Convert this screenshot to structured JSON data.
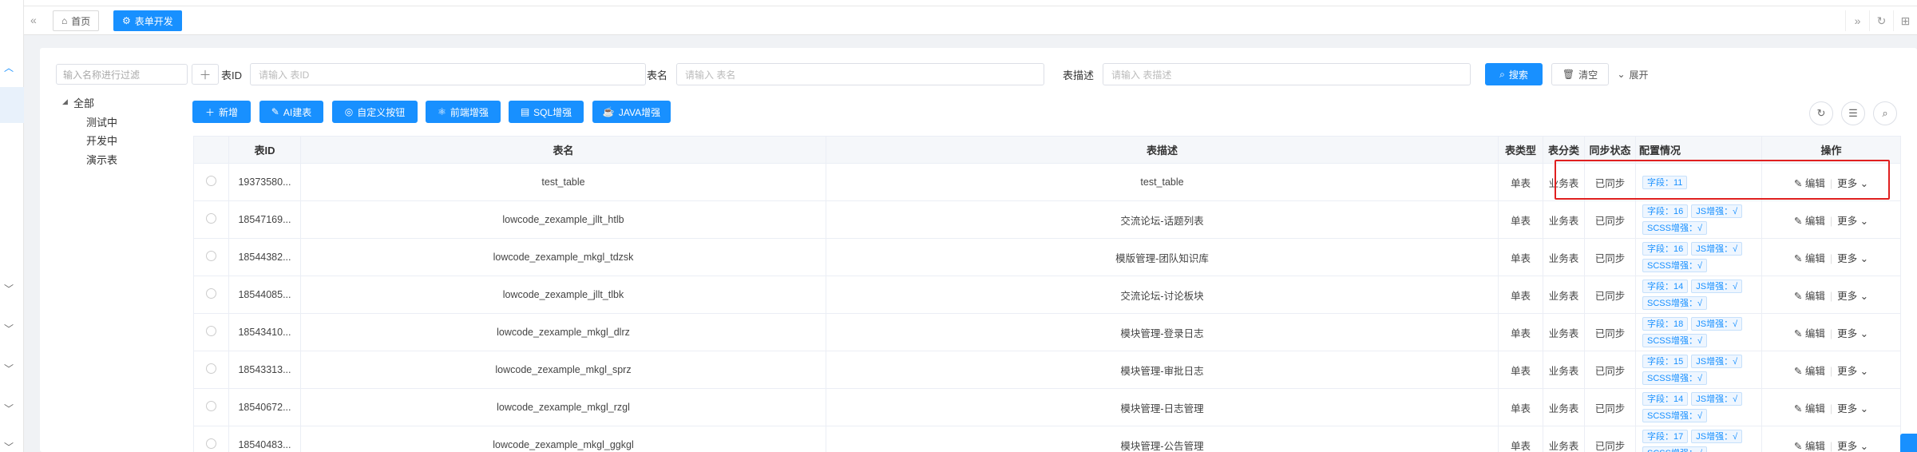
{
  "tabs": [
    {
      "label": "首页",
      "icon": "home-icon"
    },
    {
      "label": "表单开发",
      "icon": "form-icon"
    }
  ],
  "tree": {
    "search_placeholder": "输入名称进行过滤",
    "root": "全部",
    "children": [
      "测试中",
      "开发中",
      "演示表"
    ]
  },
  "query": {
    "id_label": "表ID",
    "id_placeholder": "请输入 表ID",
    "name_label": "表名",
    "name_placeholder": "请输入 表名",
    "desc_label": "表描述",
    "desc_placeholder": "请输入 表描述",
    "search": "搜索",
    "clear": "清空",
    "expand": "展开"
  },
  "toolbar": {
    "add": "新增",
    "ai": "AI建表",
    "custom": "自定义按钮",
    "frontend": "前端增强",
    "sql": "SQL增强",
    "java": "JAVA增强"
  },
  "columns": [
    "表ID",
    "表名",
    "表描述",
    "表类型",
    "表分类",
    "同步状态",
    "配置情况",
    "操作"
  ],
  "rows": [
    {
      "id": "19373580...",
      "name": "test_table",
      "desc": "test_table",
      "type": "单表",
      "category": "业务表",
      "sync": "已同步",
      "tags": [
        "字段：11"
      ]
    },
    {
      "id": "18547169...",
      "name": "lowcode_zexample_jllt_htlb",
      "desc": "交流论坛-话题列表",
      "type": "单表",
      "category": "业务表",
      "sync": "已同步",
      "tags": [
        "字段：16",
        "JS增强：√",
        "SCSS增强：√"
      ]
    },
    {
      "id": "18544382...",
      "name": "lowcode_zexample_mkgl_tdzsk",
      "desc": "模版管理-团队知识库",
      "type": "单表",
      "category": "业务表",
      "sync": "已同步",
      "tags": [
        "字段：16",
        "JS增强：√",
        "SCSS增强：√"
      ]
    },
    {
      "id": "18544085...",
      "name": "lowcode_zexample_jllt_tlbk",
      "desc": "交流论坛-讨论板块",
      "type": "单表",
      "category": "业务表",
      "sync": "已同步",
      "tags": [
        "字段：14",
        "JS增强：√",
        "SCSS增强：√"
      ]
    },
    {
      "id": "18543410...",
      "name": "lowcode_zexample_mkgl_dlrz",
      "desc": "模块管理-登录日志",
      "type": "单表",
      "category": "业务表",
      "sync": "已同步",
      "tags": [
        "字段：18",
        "JS增强：√",
        "SCSS增强：√"
      ]
    },
    {
      "id": "18543313...",
      "name": "lowcode_zexample_mkgl_sprz",
      "desc": "模块管理-审批日志",
      "type": "单表",
      "category": "业务表",
      "sync": "已同步",
      "tags": [
        "字段：15",
        "JS增强：√",
        "SCSS增强：√"
      ]
    },
    {
      "id": "18540672...",
      "name": "lowcode_zexample_mkgl_rzgl",
      "desc": "模块管理-日志管理",
      "type": "单表",
      "category": "业务表",
      "sync": "已同步",
      "tags": [
        "字段：14",
        "JS增强：√",
        "SCSS增强：√"
      ]
    },
    {
      "id": "18540483...",
      "name": "lowcode_zexample_mkgl_ggkgl",
      "desc": "模块管理-公告管理",
      "type": "单表",
      "category": "业务表",
      "sync": "已同步",
      "tags": [
        "字段：17",
        "JS增强：√",
        "SCSS增强：√"
      ]
    }
  ],
  "actions": {
    "edit": "编辑",
    "more": "更多"
  },
  "colors": {
    "primary": "#1890ff",
    "success": "#52c41a",
    "highlight": "#e02020"
  }
}
